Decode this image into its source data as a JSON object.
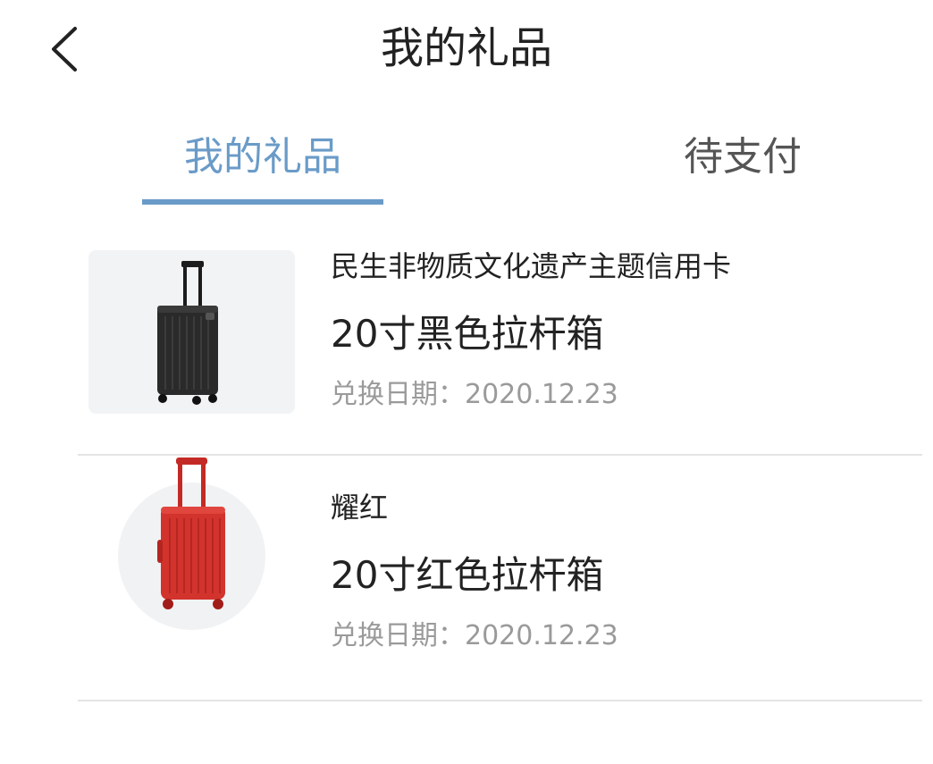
{
  "header": {
    "title": "我的礼品",
    "back_icon": "chevron-left-icon"
  },
  "tabs": [
    {
      "label": "我的礼品",
      "active": true
    },
    {
      "label": "待支付",
      "active": false
    }
  ],
  "colors": {
    "accent": "#6a9bc8",
    "text_primary": "#222222",
    "text_muted": "#9a9a9a",
    "divider": "#e4e4e4",
    "suitcase_black": "#222222",
    "suitcase_red": "#cc2b27"
  },
  "gifts": [
    {
      "card": "民生非物质文化遗产主题信用卡",
      "name": "20寸黑色拉杆箱",
      "date": "兑换日期：2020.12.23",
      "image": "black-suitcase"
    },
    {
      "card": "耀红",
      "name": "20寸红色拉杆箱",
      "date": "兑换日期：2020.12.23",
      "image": "red-suitcase"
    }
  ]
}
